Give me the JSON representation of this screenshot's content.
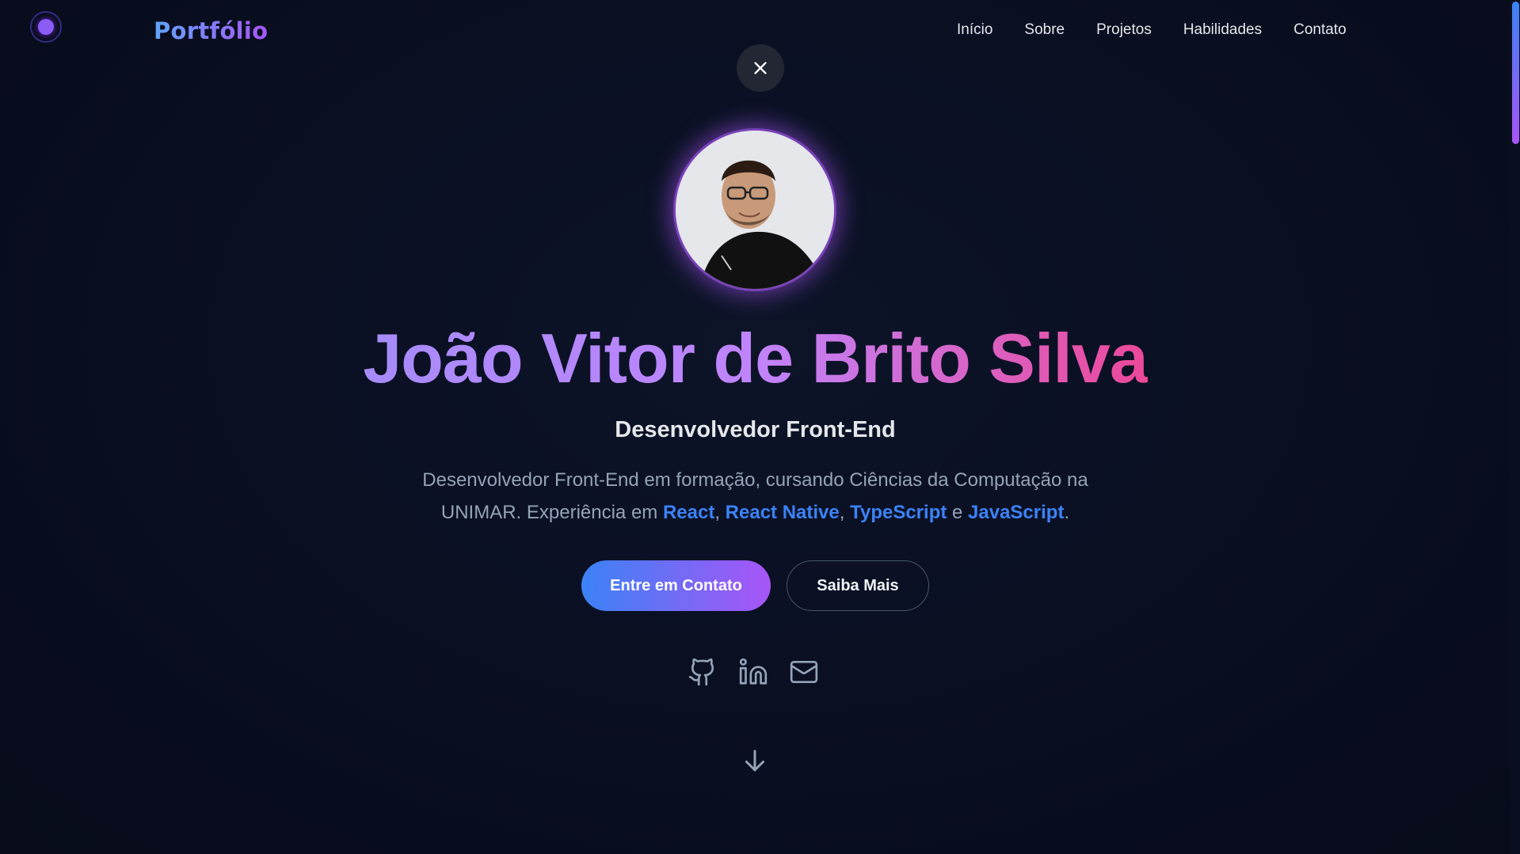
{
  "header": {
    "brand": "Portfólio",
    "nav": [
      "Início",
      "Sobre",
      "Projetos",
      "Habilidades",
      "Contato"
    ]
  },
  "hero": {
    "name": "João Vitor de Brito Silva",
    "role": "Desenvolvedor Front-End",
    "description": {
      "line1": "Desenvolvedor Front-End em formação, cursando Ciências da Computação na",
      "line2_prefix": "UNIMAR. Experiência em ",
      "skills": [
        "React",
        "React Native",
        "TypeScript",
        "JavaScript"
      ],
      "sep1": ", ",
      "sep2": ", ",
      "sep3": " e ",
      "end": "."
    },
    "primary_button": "Entre em Contato",
    "secondary_button": "Saiba Mais"
  },
  "icons": {
    "close": "close-icon",
    "socials": [
      "github-icon",
      "linkedin-icon",
      "mail-icon"
    ],
    "scroll": "arrow-down-icon"
  },
  "colors": {
    "background": "#070b1a",
    "accent_blue": "#3b82f6",
    "accent_purple": "#a855f7",
    "accent_pink": "#ec4899"
  }
}
